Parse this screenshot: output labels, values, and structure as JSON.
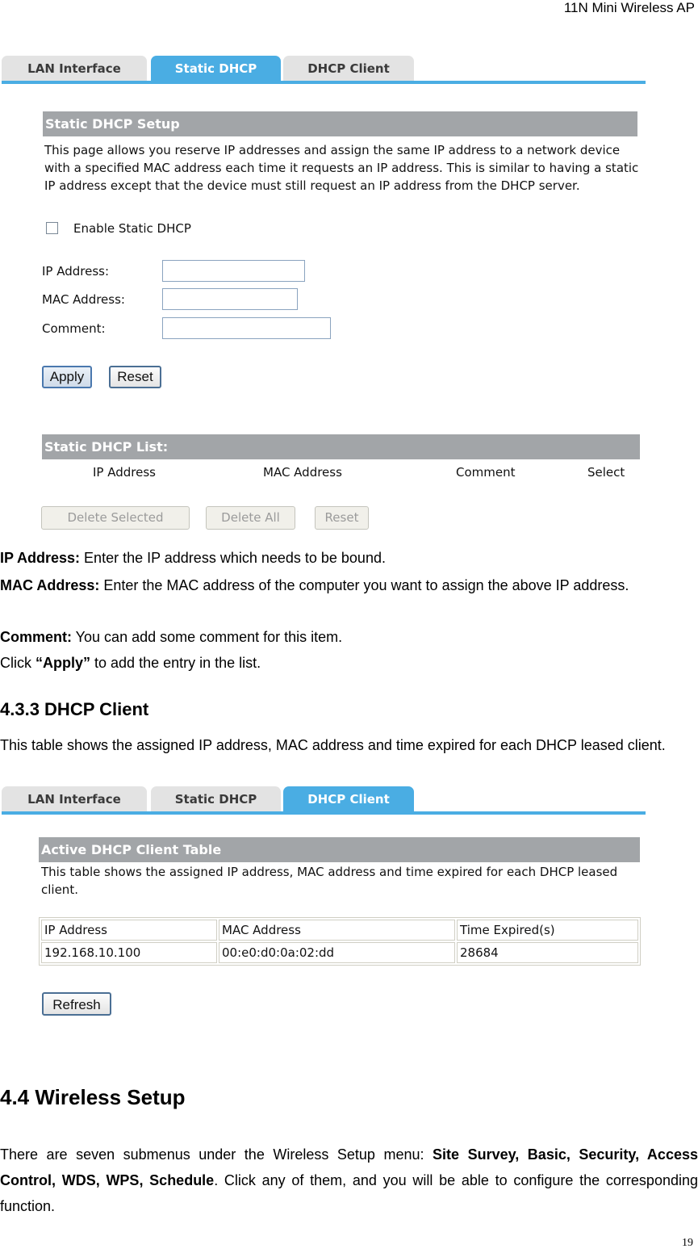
{
  "running_header": "11N Mini Wireless AP",
  "page_number": "19",
  "static_dhcp_screen": {
    "tabs": [
      {
        "label": "LAN Interface",
        "active": false
      },
      {
        "label": "Static DHCP",
        "active": true
      },
      {
        "label": "DHCP Client",
        "active": false
      }
    ],
    "setup_title": "Static DHCP Setup",
    "description": "This page allows you reserve IP addresses and assign the same IP address to a network device with a specified MAC address each time it requests an IP address. This is similar to having a static IP address except that the device must still request an IP address from the DHCP server.",
    "enable_checkbox": {
      "label": "Enable Static DHCP",
      "checked": false
    },
    "fields": [
      {
        "label": "IP Address:",
        "value": ""
      },
      {
        "label": "MAC Address:",
        "value": ""
      },
      {
        "label": "Comment:",
        "value": ""
      }
    ],
    "apply_label": "Apply",
    "reset_label": "Reset",
    "list_title": "Static DHCP List:",
    "list_columns": [
      "IP Address",
      "MAC Address",
      "Comment",
      "Select"
    ],
    "list_buttons": {
      "delete_selected": "Delete Selected",
      "delete_all": "Delete All",
      "reset": "Reset"
    }
  },
  "field_help": [
    {
      "term": "IP Address:",
      "text": " Enter the IP address which needs to be bound."
    },
    {
      "term": "MAC Address:",
      "text": " Enter the MAC address of the computer you want to assign the above IP address."
    },
    {
      "term": "Comment:",
      "text": " You can add some comment for this item."
    }
  ],
  "apply_help": {
    "prefix": "Click ",
    "term": "“Apply”",
    "suffix": " to add the entry in the list."
  },
  "section_433": {
    "heading": "4.3.3 DHCP Client",
    "intro": "This table shows the assigned IP address, MAC address and time expired for each DHCP leased client."
  },
  "dhcp_client_screen": {
    "tabs": [
      {
        "label": "LAN Interface",
        "active": false
      },
      {
        "label": "Static DHCP",
        "active": false
      },
      {
        "label": "DHCP Client",
        "active": true
      }
    ],
    "table_title": "Active DHCP Client Table",
    "description": "This table shows the assigned IP address, MAC address and time expired for each DHCP leased client.",
    "columns": [
      "IP Address",
      "MAC Address",
      "Time Expired(s)"
    ],
    "rows": [
      {
        "ip": "192.168.10.100",
        "mac": "00:e0:d0:0a:02:dd",
        "expires": "28684"
      }
    ],
    "refresh_label": "Refresh"
  },
  "section_44": {
    "heading": "4.4 Wireless Setup",
    "para_prefix": "There are seven submenus under the Wireless Setup menu: ",
    "para_bold": "Site Survey, Basic, Security, Access Control, WDS, WPS, Schedule",
    "para_suffix": ". Click any of them, and you will be able to configure the corresponding function."
  }
}
